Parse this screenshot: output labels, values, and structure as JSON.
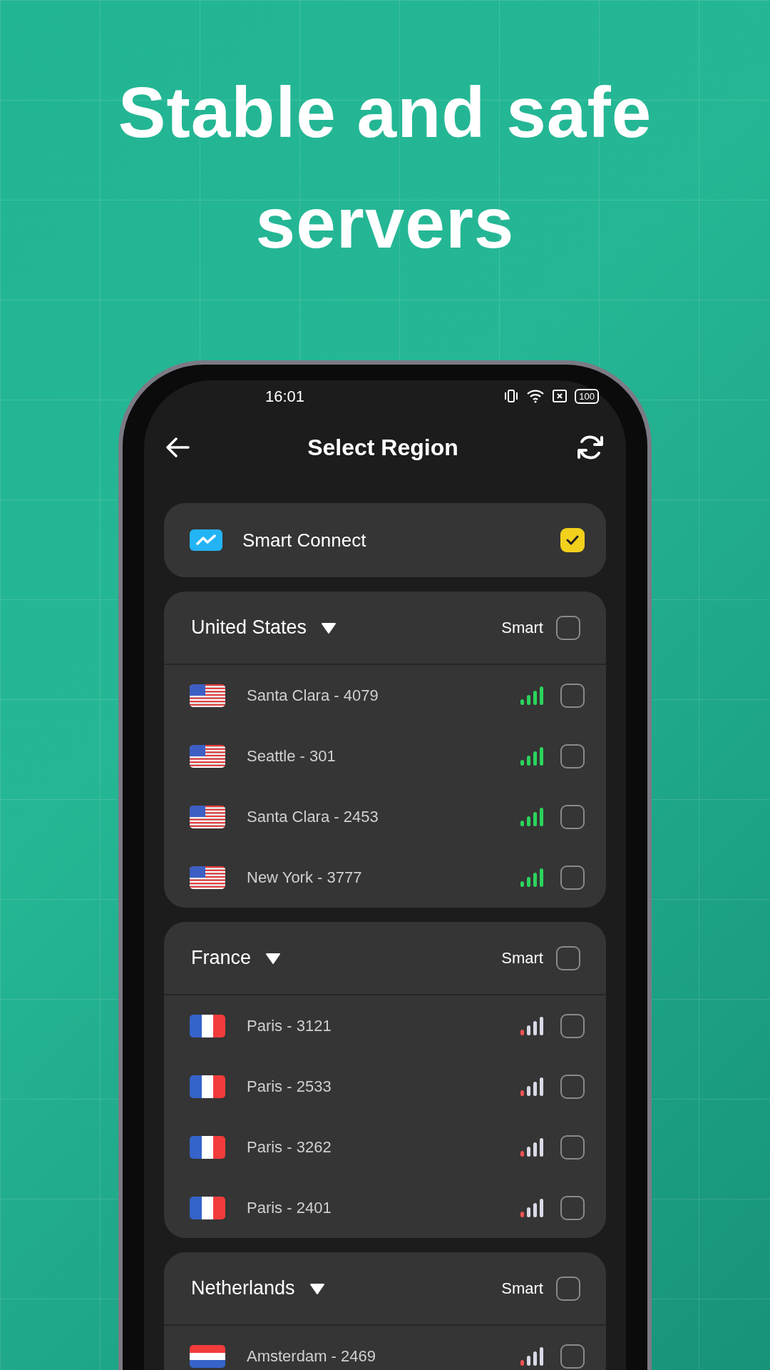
{
  "headline": "Stable and safe servers",
  "status_bar": {
    "time": "16:01",
    "battery": "100"
  },
  "header": {
    "title": "Select Region"
  },
  "smart_connect": {
    "label": "Smart Connect",
    "checked": true
  },
  "groups": [
    {
      "country": "United States",
      "smart_label": "Smart",
      "checked": false,
      "servers": [
        {
          "name": "Santa Clara - 4079",
          "kind": "us",
          "signal": {
            "kind": "strong"
          },
          "checked": false
        },
        {
          "name": "Seattle - 301",
          "kind": "us",
          "signal": {
            "kind": "strong"
          },
          "checked": false
        },
        {
          "name": "Santa Clara - 2453",
          "kind": "us",
          "signal": {
            "kind": "strong"
          },
          "checked": false
        },
        {
          "name": "New York - 3777",
          "kind": "us",
          "signal": {
            "kind": "strong"
          },
          "checked": false
        }
      ]
    },
    {
      "country": "France",
      "smart_label": "Smart",
      "checked": false,
      "servers": [
        {
          "name": "Paris - 3121",
          "kind": "fr",
          "signal": {
            "kind": "weak"
          },
          "checked": false
        },
        {
          "name": "Paris - 2533",
          "kind": "fr",
          "signal": {
            "kind": "weak"
          },
          "checked": false
        },
        {
          "name": "Paris - 3262",
          "kind": "fr",
          "signal": {
            "kind": "weak"
          },
          "checked": false
        },
        {
          "name": "Paris - 2401",
          "kind": "fr",
          "signal": {
            "kind": "weak"
          },
          "checked": false
        }
      ]
    },
    {
      "country": "Netherlands",
      "smart_label": "Smart",
      "checked": false,
      "servers": [
        {
          "name": "Amsterdam - 2469",
          "kind": "nl",
          "signal": {
            "kind": "weak"
          },
          "checked": false
        }
      ]
    }
  ]
}
